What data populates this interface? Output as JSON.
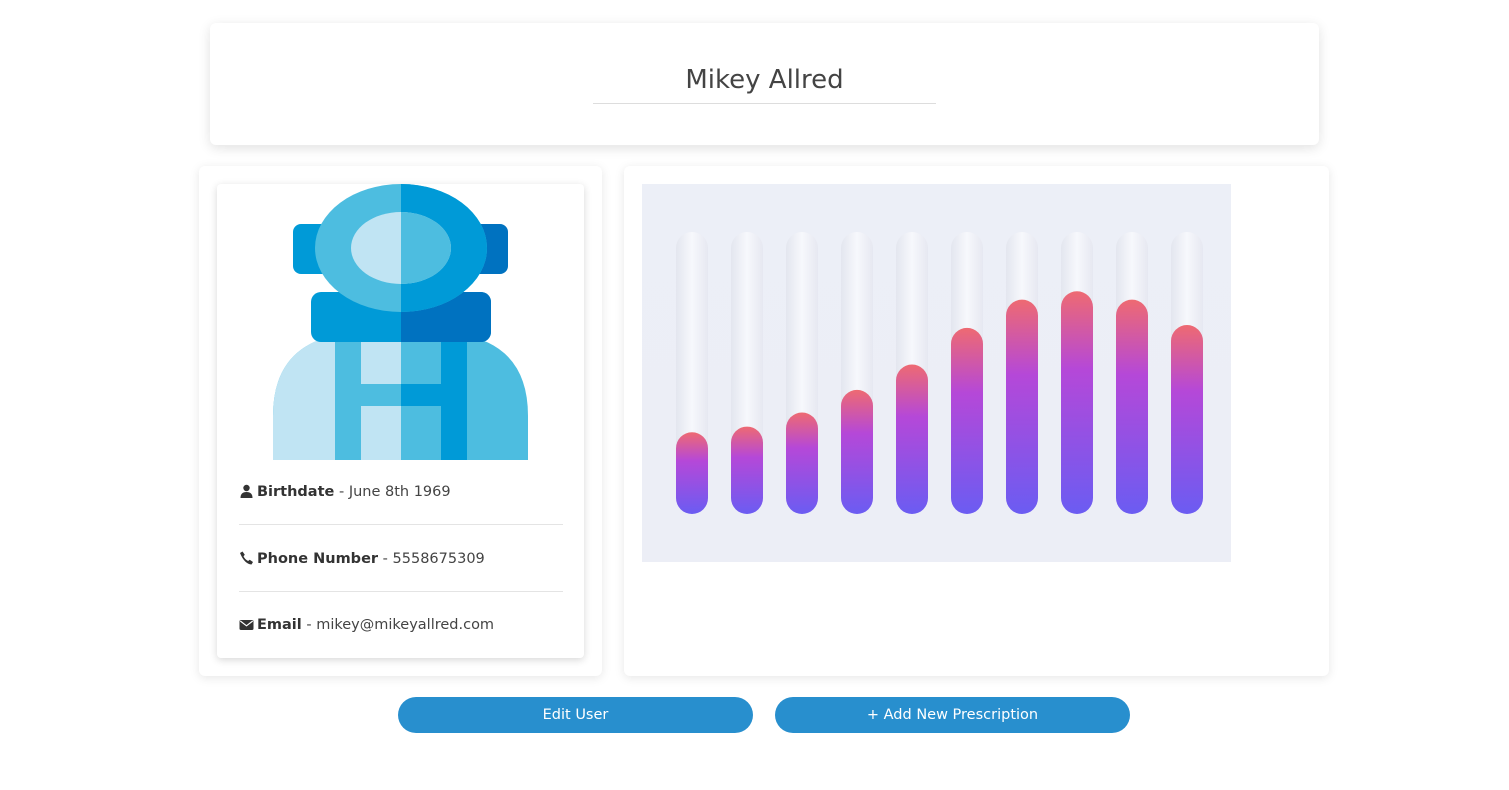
{
  "header": {
    "title": "Mikey Allred"
  },
  "profile": {
    "avatar_icon": "astronaut-avatar-icon",
    "birthdate": {
      "icon": "user-icon",
      "label": "Birthdate",
      "separator": " - ",
      "value": "June 8th 1969"
    },
    "phone": {
      "icon": "phone-icon",
      "label": "Phone Number",
      "separator": " - ",
      "value": "5558675309"
    },
    "email": {
      "icon": "envelope-icon",
      "label": "Email",
      "separator": " - ",
      "value": "mikey@mikeyallred.com"
    }
  },
  "illustration": {
    "icon": "bar-levels-illustration",
    "bar_levels": [
      0.29,
      0.31,
      0.36,
      0.44,
      0.53,
      0.66,
      0.76,
      0.79,
      0.76,
      0.67
    ]
  },
  "actions": {
    "edit_label": "Edit User",
    "add_label": "+ Add New Prescription"
  },
  "colors": {
    "button": "#288fce",
    "bar_top": "#ee6a72",
    "bar_mid": "#b548d8",
    "bar_bottom": "#6b5cf2"
  }
}
